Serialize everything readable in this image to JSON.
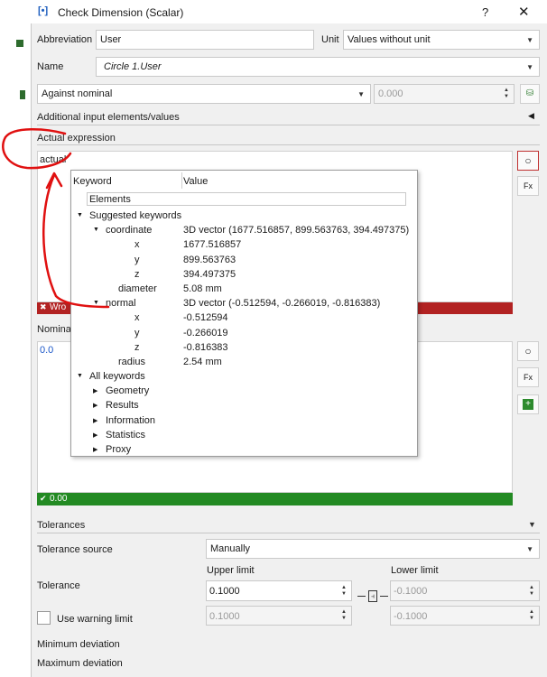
{
  "window": {
    "title": "Check Dimension (Scalar)",
    "help": "?",
    "close": "✕"
  },
  "abbreviation": {
    "label": "Abbreviation",
    "value": "User"
  },
  "unit": {
    "label": "Unit",
    "value": "Values without unit"
  },
  "name": {
    "label": "Name",
    "value": "Circle 1.User"
  },
  "mode": {
    "value": "Against nominal",
    "number": "0.000"
  },
  "additional_label": "Additional input elements/values",
  "actual_expression": {
    "label": "Actual expression",
    "value": "actual",
    "error_text": "Wro"
  },
  "nominal": {
    "label": "Nomina",
    "value": "0.0",
    "status": "0.00"
  },
  "side_buttons": {
    "fx": "Fx"
  },
  "popup": {
    "col_keyword": "Keyword",
    "col_value": "Value",
    "filter": "Elements",
    "rows": [
      {
        "k": "Suggested keywords",
        "v": ""
      },
      {
        "k": "coordinate",
        "v": "3D vector (1677.516857, 899.563763, 394.497375)"
      },
      {
        "k": "x",
        "v": "1677.516857"
      },
      {
        "k": "y",
        "v": "899.563763"
      },
      {
        "k": "z",
        "v": "394.497375"
      },
      {
        "k": "diameter",
        "v": "5.08 mm"
      },
      {
        "k": "normal",
        "v": "3D vector (-0.512594, -0.266019, -0.816383)"
      },
      {
        "k": "x",
        "v": "-0.512594"
      },
      {
        "k": "y",
        "v": "-0.266019"
      },
      {
        "k": "z",
        "v": "-0.816383"
      },
      {
        "k": "radius",
        "v": "2.54 mm"
      },
      {
        "k": "All keywords",
        "v": ""
      },
      {
        "k": "Geometry",
        "v": ""
      },
      {
        "k": "Results",
        "v": ""
      },
      {
        "k": "Information",
        "v": ""
      },
      {
        "k": "Statistics",
        "v": ""
      },
      {
        "k": "Proxy",
        "v": ""
      }
    ]
  },
  "tolerances": {
    "label": "Tolerances",
    "source_label": "Tolerance source",
    "source_value": "Manually",
    "upper_label": "Upper limit",
    "lower_label": "Lower limit",
    "tolerance_label": "Tolerance",
    "upper_value": "0.1000",
    "lower_value": "-0.1000",
    "warning_label": "Use warning limit",
    "warning_upper": "0.1000",
    "warning_lower": "-0.1000",
    "min_dev_label": "Minimum deviation",
    "max_dev_label": "Maximum deviation"
  },
  "colors": {
    "annotation_red": "#e01010",
    "error_bar": "#b22222",
    "ok_bar": "#238a23",
    "nominal_text": "#1a56c8"
  }
}
